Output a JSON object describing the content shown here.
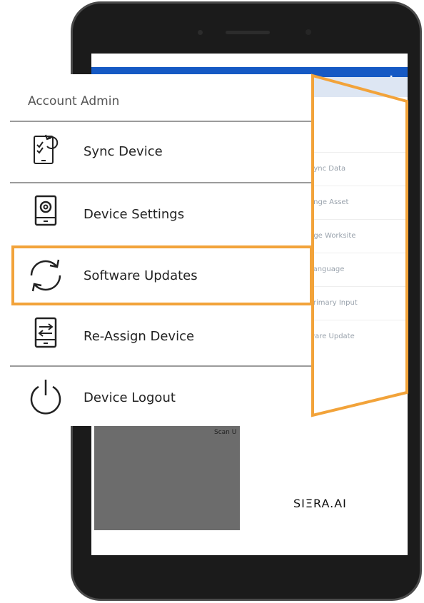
{
  "drawer": {
    "title": "Account Admin",
    "items": [
      {
        "label": "Sync Device",
        "icon": "sync-device-icon"
      },
      {
        "label": "Device Settings",
        "icon": "device-settings-icon"
      },
      {
        "label": "Software Updates",
        "icon": "refresh-icon",
        "highlighted": true
      },
      {
        "label": "Re-Assign Device",
        "icon": "reassign-device-icon"
      },
      {
        "label": "Device Logout",
        "icon": "power-icon"
      }
    ]
  },
  "background_menu": {
    "items": [
      "Sync Data",
      "ange Asset",
      "nge Worksite",
      "Language",
      "Primary Input",
      "ware Update"
    ]
  },
  "scan_label": "Scan U",
  "logo": "SIΞRA.AI",
  "colors": {
    "app_bar": "#1559c4",
    "highlight": "#f2a33a",
    "drawer_bg": "#ffffff",
    "scan_box": "#6c6c6c"
  }
}
